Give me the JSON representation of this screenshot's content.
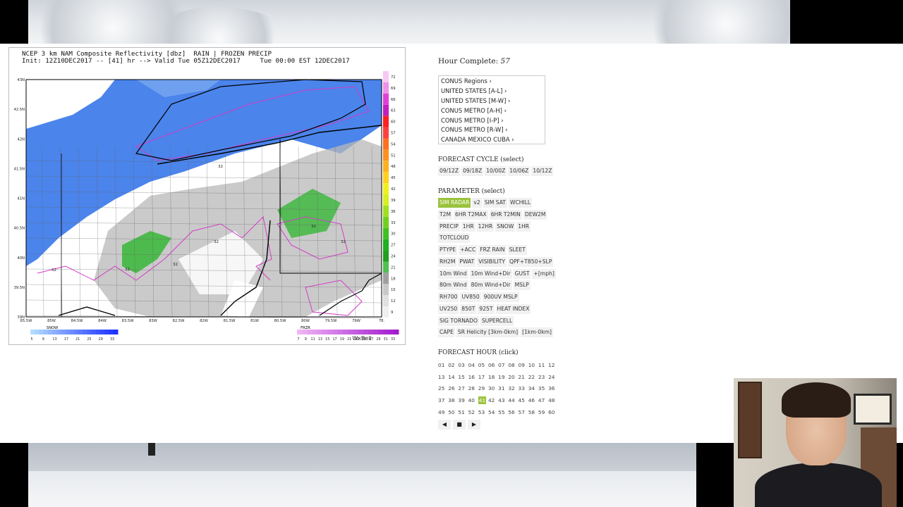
{
  "map": {
    "title_line1": "NCEP 3 km NAM Composite Reflectivity [dbz]  RAIN | FROZEN PRECIP",
    "title_line2": "Init: 12Z10DEC2017 -- [41] hr --> Valid Tue 05Z12DEC2017     Tue 00:00 EST 12DEC2017",
    "lat_labels": [
      "43N",
      "42.5N",
      "42N",
      "41.5N",
      "41N",
      "40.5N",
      "40N",
      "39.5N",
      "39N"
    ],
    "lon_labels": [
      "85.5W",
      "85W",
      "84.5W",
      "84W",
      "83.5W",
      "83W",
      "82.5W",
      "82W",
      "81.5W",
      "81W",
      "80.5W",
      "80W",
      "79.5W",
      "79W",
      "78."
    ],
    "colorbar_ticks": [
      "72",
      "69",
      "66",
      "63",
      "60",
      "57",
      "54",
      "51",
      "48",
      "45",
      "42",
      "39",
      "36",
      "33",
      "30",
      "27",
      "24",
      "21",
      "18",
      "15",
      "12",
      "9"
    ],
    "contour_labels": [
      "32",
      "32",
      "32",
      "32",
      "32",
      "32",
      "32"
    ],
    "snow_legend": {
      "label": "SNOW",
      "ticks": [
        "5",
        "9",
        "13",
        "17",
        "21",
        "25",
        "29",
        "33"
      ]
    },
    "frzr_legend": {
      "label": "FRZR",
      "ticks": [
        "7",
        "9",
        "11",
        "13",
        "15",
        "17",
        "19",
        "21",
        "23",
        "25",
        "27",
        "29",
        "31",
        "33"
      ]
    },
    "watermark": "WxBell",
    "colors": {
      "snow": "#2b6ee8",
      "rain_green": "#2db52d",
      "gray": "#b8b8b8",
      "mix_magenta": "#d43bc9",
      "boundary": "#000000"
    }
  },
  "controls": {
    "hour_complete_label": "Hour Complete:",
    "hour_complete_value": "57",
    "regions": [
      "CONUS Regions ›",
      "UNITED STATES [A-L] ›",
      "UNITED STATES [M-W] ›",
      "CONUS METRO [A-H] ›",
      "CONUS METRO [I-P] ›",
      "CONUS METRO [R-W] ›",
      "CANADA MEXICO CUBA ›"
    ],
    "forecast_cycle_title": "FORECAST CYCLE (select)",
    "cycles": [
      "09/12Z",
      "09/18Z",
      "10/00Z",
      "10/06Z",
      "10/12Z"
    ],
    "parameter_title": "PARAMETER (select)",
    "param_rows": [
      [
        "SIM RADAR",
        "v2",
        "SIM SAT",
        "WCHILL"
      ],
      [
        "T2M",
        "6HR T2MAX",
        "6HR T2MIN",
        "DEW2M"
      ],
      [
        "PRECIP",
        "1HR",
        "12HR",
        "SNOW",
        "1HR"
      ],
      [
        "TOTCLOUD"
      ],
      [
        "PTYPE",
        "+ACC",
        "FRZ RAIN",
        "SLEET"
      ],
      [
        "RH2M",
        "PWAT",
        "VISIBILITY",
        "QPF+T850+SLP"
      ],
      [
        "10m Wind",
        "10m Wind+Dir",
        "GUST",
        "+[mph]"
      ],
      [
        "80m Wind",
        "80m Wind+Dir",
        "MSLP"
      ],
      [
        "RH700",
        "UV850",
        "900UV MSLP"
      ],
      [
        "UV250",
        "850T",
        "925T",
        "HEAT INDEX"
      ],
      [
        "SIG TORNADO",
        "SUPERCELL"
      ],
      [
        "CAPE",
        "SR Helicity [3km-0km]",
        "[1km-0km]"
      ]
    ],
    "active_param": "SIM RADAR",
    "forecast_hour_title": "FORECAST HOUR (click)",
    "hours": [
      [
        "01",
        "02",
        "03",
        "04",
        "05",
        "06",
        "07",
        "08",
        "09",
        "10",
        "11",
        "12"
      ],
      [
        "13",
        "14",
        "15",
        "16",
        "17",
        "18",
        "19",
        "20",
        "21",
        "22",
        "23",
        "24"
      ],
      [
        "25",
        "26",
        "27",
        "28",
        "29",
        "30",
        "31",
        "32",
        "33",
        "34",
        "35",
        "36"
      ],
      [
        "37",
        "38",
        "39",
        "40",
        "41",
        "42",
        "43",
        "44",
        "45",
        "46",
        "47",
        "48"
      ],
      [
        "49",
        "50",
        "51",
        "52",
        "53",
        "54",
        "55",
        "56",
        "57",
        "58",
        "59",
        "60"
      ]
    ],
    "active_hour": "41",
    "player": {
      "prev": "◀",
      "stop": "■",
      "next": "▶"
    }
  }
}
